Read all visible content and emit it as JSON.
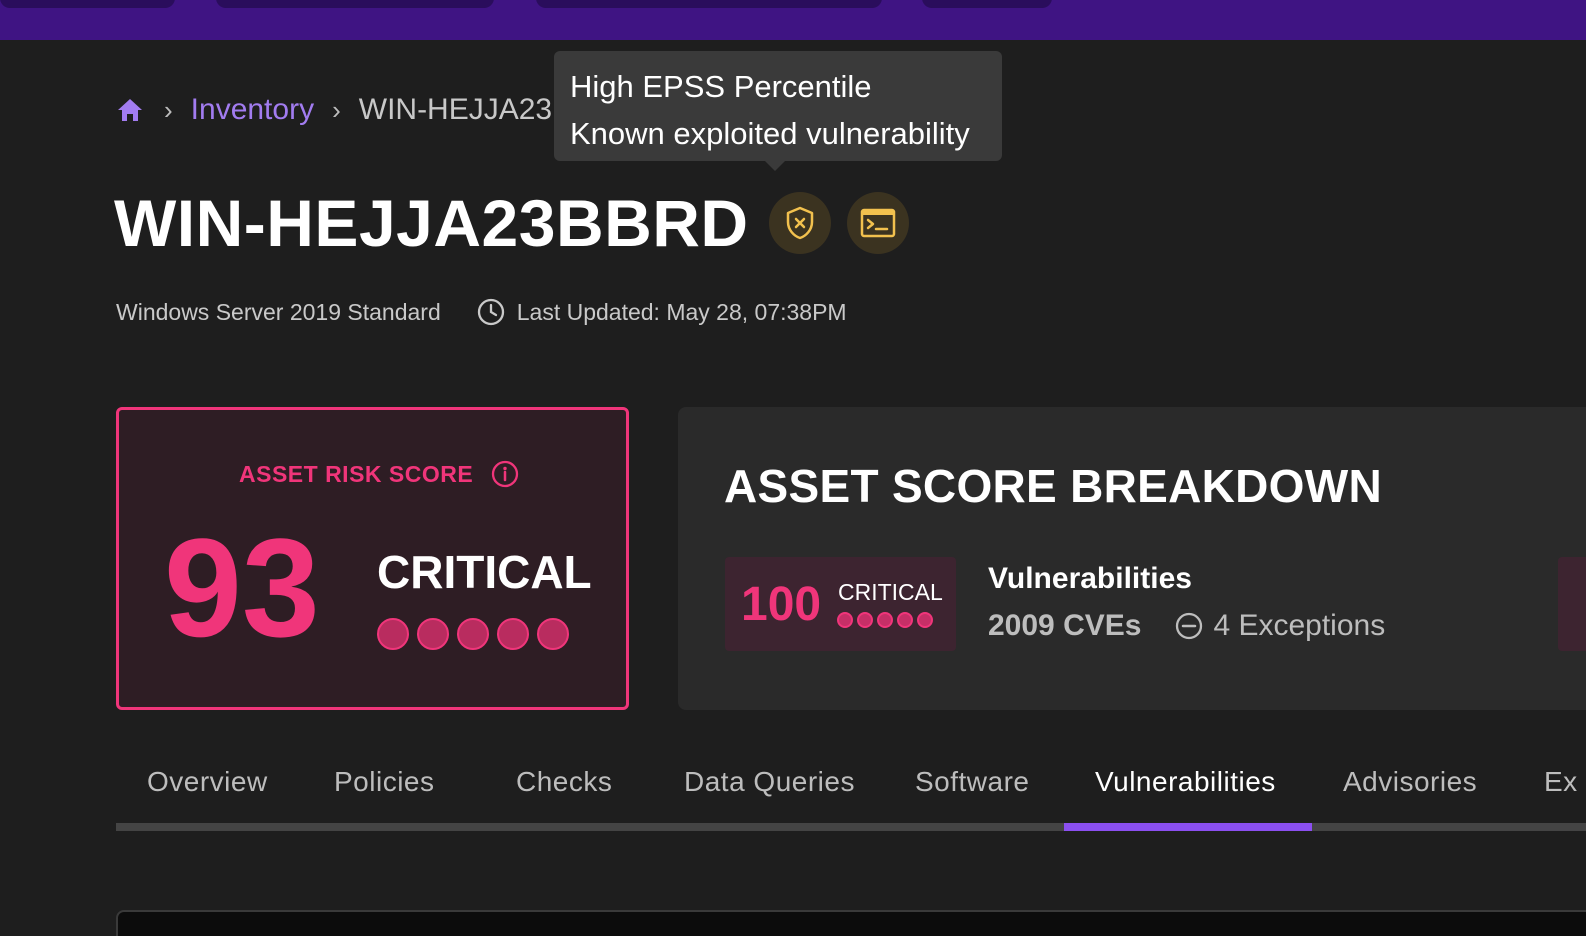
{
  "theme": {
    "topbar": "#3f1483",
    "accent": "#a27cf0",
    "critical": "#f0357a",
    "warning_icon": "#f2c14e",
    "tab_indicator": "#8b4ff0"
  },
  "breadcrumb": {
    "home_icon": "home-icon",
    "items": [
      {
        "label": "Inventory"
      },
      {
        "label": "WIN-HEJJA23"
      }
    ]
  },
  "tooltip": {
    "lines": [
      "High EPSS Percentile",
      "Known exploited vulnerability"
    ]
  },
  "asset": {
    "name": "WIN-HEJJA23BBRD",
    "icons": [
      "shield-x-icon",
      "terminal-icon"
    ],
    "os": "Windows Server 2019 Standard",
    "last_updated": "Last Updated: May 28, 07:38PM"
  },
  "risk_score": {
    "label": "ASSET RISK SCORE",
    "value": "93",
    "rating": "CRITICAL",
    "rating_level": 5,
    "rating_max": 5
  },
  "breakdown": {
    "title": "ASSET SCORE BREAKDOWN",
    "items": [
      {
        "score": "100",
        "rating": "CRITICAL",
        "rating_level": 5,
        "name": "Vulnerabilities",
        "cves": "2009 CVEs",
        "exceptions": "4 Exceptions"
      }
    ]
  },
  "tabs": [
    {
      "label": "Overview"
    },
    {
      "label": "Policies"
    },
    {
      "label": "Checks"
    },
    {
      "label": "Data Queries"
    },
    {
      "label": "Software"
    },
    {
      "label": "Vulnerabilities",
      "active": true
    },
    {
      "label": "Advisories"
    },
    {
      "label": "Ex"
    }
  ]
}
